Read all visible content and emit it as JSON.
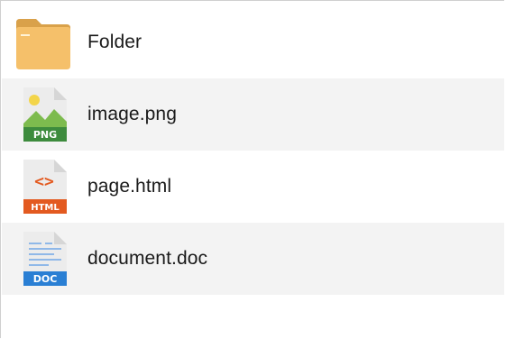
{
  "files": [
    {
      "name": "Folder",
      "icon": "folder-icon",
      "type_badge": ""
    },
    {
      "name": "image.png",
      "icon": "png-file-icon",
      "type_badge": "PNG"
    },
    {
      "name": "page.html",
      "icon": "html-file-icon",
      "type_badge": "HTML"
    },
    {
      "name": "document.doc",
      "icon": "doc-file-icon",
      "type_badge": "DOC"
    }
  ],
  "colors": {
    "folder": "#f5c06a",
    "folder_tab": "#d9a14a",
    "png_badge": "#3d8b3d",
    "png_hill": "#7dbb4e",
    "png_sun": "#f3d54a",
    "html_badge": "#e35a20",
    "doc_badge": "#2a7fd4",
    "row_alt_bg": "#f3f3f3"
  }
}
